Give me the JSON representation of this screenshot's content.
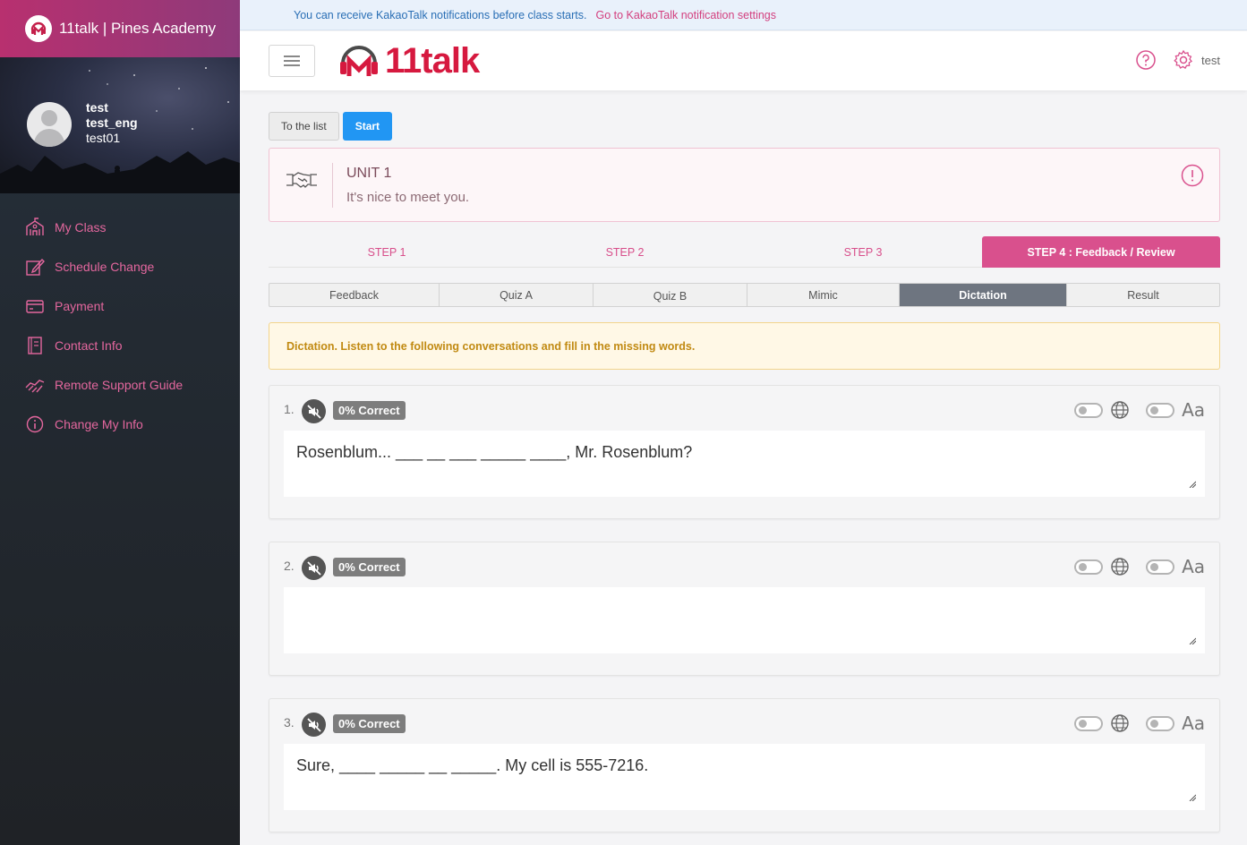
{
  "sidebar": {
    "brand": "11talk | Pines Academy",
    "profile": {
      "name": "test",
      "eng_name": "test_eng",
      "id": "test01"
    },
    "menu": [
      {
        "label": "My Class",
        "icon": "school-icon"
      },
      {
        "label": "Schedule Change",
        "icon": "edit-icon"
      },
      {
        "label": "Payment",
        "icon": "card-icon"
      },
      {
        "label": "Contact Info",
        "icon": "book-icon"
      },
      {
        "label": "Remote Support Guide",
        "icon": "handshake-icon"
      },
      {
        "label": "Change My Info",
        "icon": "info-icon"
      }
    ]
  },
  "notice": {
    "message": "You can receive KakaoTalk notifications before class starts.",
    "link": "Go to KakaoTalk notification settings"
  },
  "header": {
    "logo_text": "11talk",
    "user": "test"
  },
  "toolbar": {
    "list_label": "To the list",
    "start_label": "Start"
  },
  "unit": {
    "title": "UNIT 1",
    "subtitle": "It's nice to meet you."
  },
  "steps": [
    "STEP 1",
    "STEP 2",
    "STEP 3",
    "STEP 4 : Feedback / Review"
  ],
  "active_step": 3,
  "subtabs": [
    "Feedback",
    "Quiz A",
    "Quiz B",
    "Mimic",
    "Dictation",
    "Result"
  ],
  "active_subtab": 4,
  "instruction": "Dictation. Listen to the following conversations and fill in the missing words.",
  "questions": [
    {
      "num": "1.",
      "badge": "0% Correct",
      "text": "Rosenblum... ___ __ ___ _____ ____, Mr. Rosenblum?"
    },
    {
      "num": "2.",
      "badge": "0% Correct",
      "text": ""
    },
    {
      "num": "3.",
      "badge": "0% Correct",
      "text": "Sure, ____ _____ __ _____. My cell is 555-7216."
    }
  ],
  "tools": {
    "font_toggle_label": "Aa"
  },
  "colors": {
    "accent": "#d9508d",
    "primary": "#2196f3",
    "brand_red": "#d6193f"
  }
}
